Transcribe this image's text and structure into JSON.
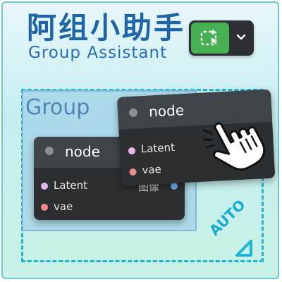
{
  "header": {
    "title_cn": "阿组小助手",
    "title_en": "Group Assistant"
  },
  "toolbar": {
    "main_icon": "sparkle-select-icon",
    "dropdown_icon": "chevron-down-icon"
  },
  "canvas": {
    "group_title": "Group",
    "auto_label": "AUTO",
    "nodes": [
      {
        "title": "node",
        "inputs": [
          {
            "label": "Latent",
            "color": "#e8b6e6"
          },
          {
            "label": "vae",
            "color": "#f08a8a"
          }
        ],
        "output": {
          "label": "图像",
          "color": "#6fb0e8"
        }
      },
      {
        "title": "node",
        "inputs": [
          {
            "label": "Latent",
            "color": "#e8b6e6"
          },
          {
            "label": "vae",
            "color": "#f08a8a"
          }
        ]
      }
    ]
  },
  "colors": {
    "title_blue": "#1f64a5",
    "accent_cyan": "#1fb4d6",
    "toolbar_green": "#46b052",
    "node_body": "#2b2f32"
  },
  "cursor_icon": "hand-pointer-icon"
}
